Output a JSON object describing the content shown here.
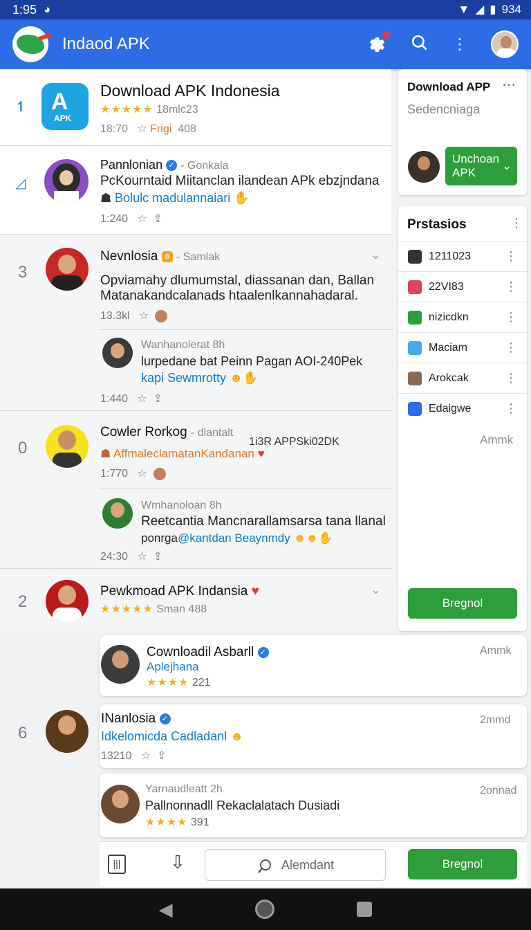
{
  "status_bar": {
    "time": "1:95",
    "battery": "934"
  },
  "app_bar": {
    "title": "Indaod APK"
  },
  "feed": {
    "top_card": {
      "title": "Download APK Indonesia",
      "rating_text": "18mlc23",
      "meta_left": "18:70",
      "meta_mid": "Frigi",
      "meta_right": "408",
      "app_icon_label": "APK"
    },
    "post1": {
      "name": "Pannlonian",
      "sub": "- Gonkala",
      "body": "PcKourntaid Miitanclan ilandean APk ebzjndana",
      "line2": "Bolulc madulannaiari",
      "time": "1:240"
    },
    "post2": {
      "rank": "3",
      "name": "Nevnlosia",
      "sub": "- Samlak",
      "body1": "Opviamahy dlumumstal, diassanan dan, Ballan",
      "body2": "Matanakandcalanads htaalenlkannahadaral.",
      "time": "13.3kl"
    },
    "reply1": {
      "name": "Wanhanolerat 8h",
      "body": "lurpedane bat Peinn Pagan AOI-240Pek",
      "line2": "kapi Sewmrotty",
      "time": "1:440"
    },
    "post3": {
      "rank": "0",
      "name": "Cowler Rorkog",
      "sub": "- dlantalt",
      "extra": "1i3R APPSki02DK",
      "line2": "AffmaleclamatanKandanan",
      "time": "1:770"
    },
    "reply2": {
      "name": "Wmhanoloan 8h",
      "body": "Reetcantia Mancnarallamsarsa tana llanal",
      "line2a": "ponrga",
      "line2b": "@kantdan Beaynmdy",
      "time": "24:30"
    },
    "post4": {
      "rank": "2",
      "name": "Pewkmoad APK Indansia",
      "stars_text": "Sman",
      "count": "488"
    }
  },
  "sidebar": {
    "card1": {
      "title": "Download APP",
      "sub": "Sedencniaga",
      "button": "Unchoan APK"
    },
    "card2": {
      "title": "Prstasios",
      "items": [
        {
          "label": "1211023",
          "color": "#333333"
        },
        {
          "label": "22VI83",
          "color": "#e0445a"
        },
        {
          "label": "nizicdkn",
          "color": "#2e9e3d"
        },
        {
          "label": "Maciam",
          "color": "#4aa9e8"
        },
        {
          "label": "Arokcak",
          "color": "#8a6a50"
        },
        {
          "label": "Edaigwe",
          "color": "#2d6ce4"
        }
      ],
      "footer_meta": "Ammk",
      "button": "Bregnol"
    }
  },
  "floats": {
    "f1": {
      "name": "Cownloadil Asbarll",
      "sub": "Aplejhana",
      "rating": "221",
      "time": "Ammk"
    },
    "f2": {
      "rank": "6",
      "name": "INanlosia",
      "sub": "Idkelomicda Cadladanl",
      "meta": "13210",
      "time": "2mmd"
    },
    "f3": {
      "name": "Yarnaudleatt 2h",
      "body": "Pallnonnadll Rekaclalatach Dusiadi",
      "rating": "391",
      "time": "2onnad"
    }
  },
  "bottom_bar": {
    "search_placeholder": "Alemdant",
    "button": "Bregnol"
  }
}
